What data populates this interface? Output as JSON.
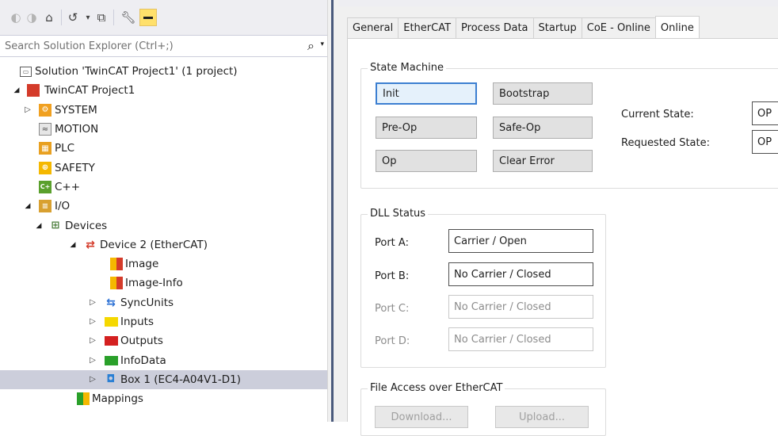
{
  "explorer": {
    "search_placeholder": "Search Solution Explorer (Ctrl+;)",
    "toolbar_icons": [
      "back-icon",
      "forward-icon",
      "home-icon",
      "history-icon",
      "collapse-all-icon",
      "show-all-files-icon",
      "properties-icon",
      "pin-icon"
    ],
    "tree": [
      {
        "label": "Solution 'TwinCAT Project1' (1 project)",
        "icon": "solution-icon",
        "icon_color": "#5a5a5a"
      },
      {
        "label": "TwinCAT Project1",
        "icon": "twincat-project-icon",
        "icon_color": "#d43b2a"
      },
      {
        "label": "SYSTEM",
        "icon": "system-icon",
        "icon_color": "#f0a020"
      },
      {
        "label": "MOTION",
        "icon": "motion-icon",
        "icon_color": "#9a9a9a"
      },
      {
        "label": "PLC",
        "icon": "plc-icon",
        "icon_color": "#e8a020"
      },
      {
        "label": "SAFETY",
        "icon": "safety-icon",
        "icon_color": "#f5b800"
      },
      {
        "label": "C++",
        "icon": "cpp-icon",
        "icon_color": "#5aa02c"
      },
      {
        "label": "I/O",
        "icon": "io-icon",
        "icon_color": "#d8a030"
      },
      {
        "label": "Devices",
        "icon": "devices-icon",
        "icon_color": "#4a7c3a"
      },
      {
        "label": "Device 2 (EtherCAT)",
        "icon": "ethercat-device-icon",
        "icon_color": "#d43b2a"
      },
      {
        "label": "Image",
        "icon": "image-icon",
        "icon_color": "#d43b2a"
      },
      {
        "label": "Image-Info",
        "icon": "image-info-icon",
        "icon_color": "#d43b2a"
      },
      {
        "label": "SyncUnits",
        "icon": "syncunits-icon",
        "icon_color": "#2a6fd4"
      },
      {
        "label": "Inputs",
        "icon": "inputs-icon",
        "icon_color": "#f5d800"
      },
      {
        "label": "Outputs",
        "icon": "outputs-icon",
        "icon_color": "#d42020"
      },
      {
        "label": "InfoData",
        "icon": "infodata-icon",
        "icon_color": "#2aa02a"
      },
      {
        "label": "Box 1 (EC4-A04V1-D1)",
        "icon": "box-icon",
        "icon_color": "#2a7fd4"
      },
      {
        "label": "Mappings",
        "icon": "mappings-icon",
        "icon_color": "#d43b2a"
      }
    ]
  },
  "tabs": [
    "General",
    "EtherCAT",
    "Process Data",
    "Startup",
    "CoE - Online",
    "Online"
  ],
  "active_tab": "Online",
  "state_machine": {
    "title": "State Machine",
    "buttons": {
      "init": "Init",
      "bootstrap": "Bootstrap",
      "pre_op": "Pre-Op",
      "safe_op": "Safe-Op",
      "op": "Op",
      "clear_error": "Clear Error"
    },
    "current_state_label": "Current State:",
    "current_state_value": "OP",
    "requested_state_label": "Requested State:",
    "requested_state_value": "OP"
  },
  "dll_status": {
    "title": "DLL Status",
    "ports": [
      {
        "label": "Port A:",
        "value": "Carrier / Open"
      },
      {
        "label": "Port B:",
        "value": "No Carrier / Closed"
      },
      {
        "label": "Port C:",
        "value": "No Carrier / Closed"
      },
      {
        "label": "Port D:",
        "value": "No Carrier / Closed"
      }
    ]
  },
  "file_access": {
    "title": "File Access over EtherCAT",
    "download": "Download...",
    "upload": "Upload..."
  },
  "colors": {
    "selection": "#cccedb",
    "focus_border": "#3c7fd1",
    "toolbar_bg": "#eeeef2"
  }
}
